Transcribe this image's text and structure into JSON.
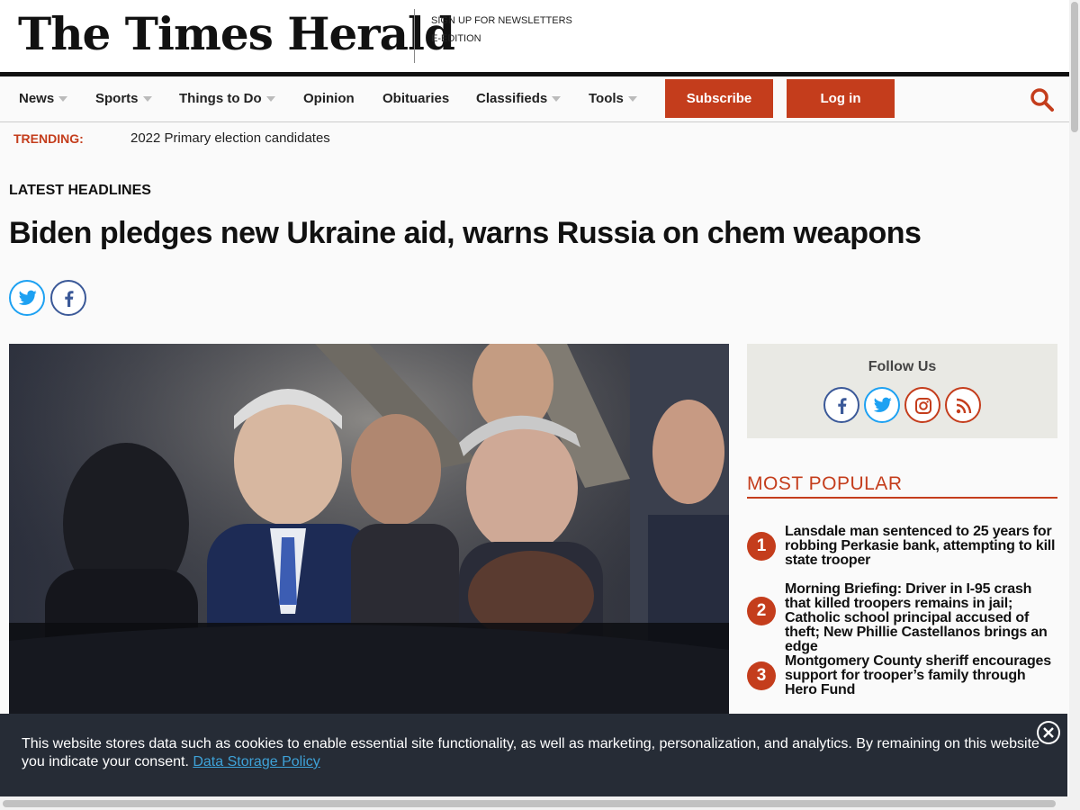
{
  "site": {
    "logo": "The Times Herald"
  },
  "masthead_links": [
    "SIGN UP FOR NEWSLETTERS",
    "E-EDITION"
  ],
  "nav": {
    "items": [
      {
        "label": "News",
        "dropdown": true
      },
      {
        "label": "Sports",
        "dropdown": true
      },
      {
        "label": "Things to Do",
        "dropdown": true
      },
      {
        "label": "Opinion",
        "dropdown": false
      },
      {
        "label": "Obituaries",
        "dropdown": false
      },
      {
        "label": "Classifieds",
        "dropdown": true
      },
      {
        "label": "Tools",
        "dropdown": true
      }
    ],
    "subscribe_label": "Subscribe",
    "login_label": "Log in",
    "search_icon": "search-icon"
  },
  "trending": {
    "label": "TRENDING:",
    "link": "2022 Primary election candidates"
  },
  "article": {
    "section": "LATEST HEADLINES",
    "headline": "Biden pledges new Ukraine aid, warns Russia on chem weapons",
    "share_icons": [
      "twitter-icon",
      "facebook-icon"
    ]
  },
  "follow": {
    "title": "Follow Us",
    "icons": [
      "facebook-icon",
      "twitter-icon",
      "instagram-icon",
      "rss-icon"
    ]
  },
  "popular": {
    "title": "MOST POPULAR",
    "items": [
      {
        "num": "1",
        "text": "Lansdale man sentenced to 25 years for robbing Perkasie bank, attempting to kill state trooper"
      },
      {
        "num": "2",
        "text": "Morning Briefing: Driver in I-95 crash that killed troopers remains in jail; Catholic school principal accused of theft; New Phillie Castellanos brings an edge"
      },
      {
        "num": "3",
        "text": "Montgomery County sheriff encourages support for trooper’s family through Hero Fund"
      }
    ]
  },
  "cookie": {
    "text": "This website stores data such as cookies to enable essential site functionality, as well as marketing, personalization, and analytics. By remaining on this website you indicate your consent.",
    "link": "Data Storage Policy"
  },
  "colors": {
    "accent": "#c43d1c",
    "banner": "#262c36",
    "twitter": "#1da1f2",
    "facebook": "#3b5998",
    "instagram": "#c13584",
    "rss": "#e0672a"
  }
}
